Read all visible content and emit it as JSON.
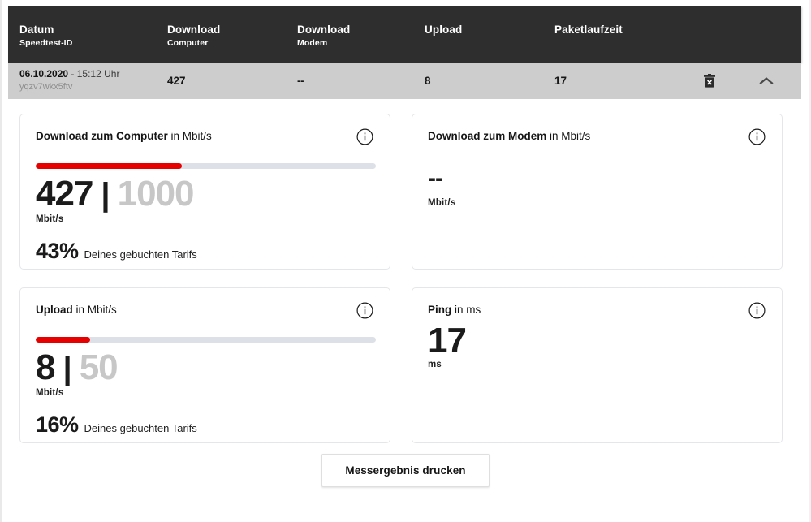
{
  "table": {
    "columns": [
      {
        "title": "Datum",
        "sub": "Speedtest-ID"
      },
      {
        "title": "Download",
        "sub": "Computer"
      },
      {
        "title": "Download",
        "sub": "Modem"
      },
      {
        "title": "Upload",
        "sub": ""
      },
      {
        "title": "Paketlaufzeit",
        "sub": ""
      }
    ],
    "row": {
      "date": "06.10.2020",
      "date_separator": "-",
      "time": "15:12 Uhr",
      "speedtest_id": "yqzv7wkx5ftv",
      "download_computer": "427",
      "download_modem": "--",
      "upload": "8",
      "paketlaufzeit": "17",
      "delete_icon": "trash-icon",
      "collapse_icon": "chevron-up-icon"
    }
  },
  "cards": {
    "download_computer": {
      "title_strong": "Download zum Computer",
      "title_light": " in Mbit/s",
      "info_icon": "info-icon",
      "value": "427",
      "separator": "|",
      "max": "1000",
      "unit": "Mbit/s",
      "percent": "43%",
      "percent_label": "Deines gebuchten Tarifs",
      "progress_percent": 43,
      "accent_color": "#e60000",
      "track_color": "#dde1e7"
    },
    "download_modem": {
      "title_strong": "Download zum Modem",
      "title_light": " in Mbit/s",
      "info_icon": "info-icon",
      "value": "--",
      "unit": "Mbit/s"
    },
    "upload": {
      "title_strong": "Upload",
      "title_light": " in Mbit/s",
      "info_icon": "info-icon",
      "value": "8",
      "separator": "|",
      "max": "50",
      "unit": "Mbit/s",
      "percent": "16%",
      "percent_label": "Deines gebuchten Tarifs",
      "progress_percent": 16,
      "accent_color": "#e60000",
      "track_color": "#dde1e7"
    },
    "ping": {
      "title_strong": "Ping",
      "title_light": " in ms",
      "info_icon": "info-icon",
      "value": "17",
      "unit": "ms"
    }
  },
  "footer": {
    "print_button": "Messergebnis drucken"
  }
}
